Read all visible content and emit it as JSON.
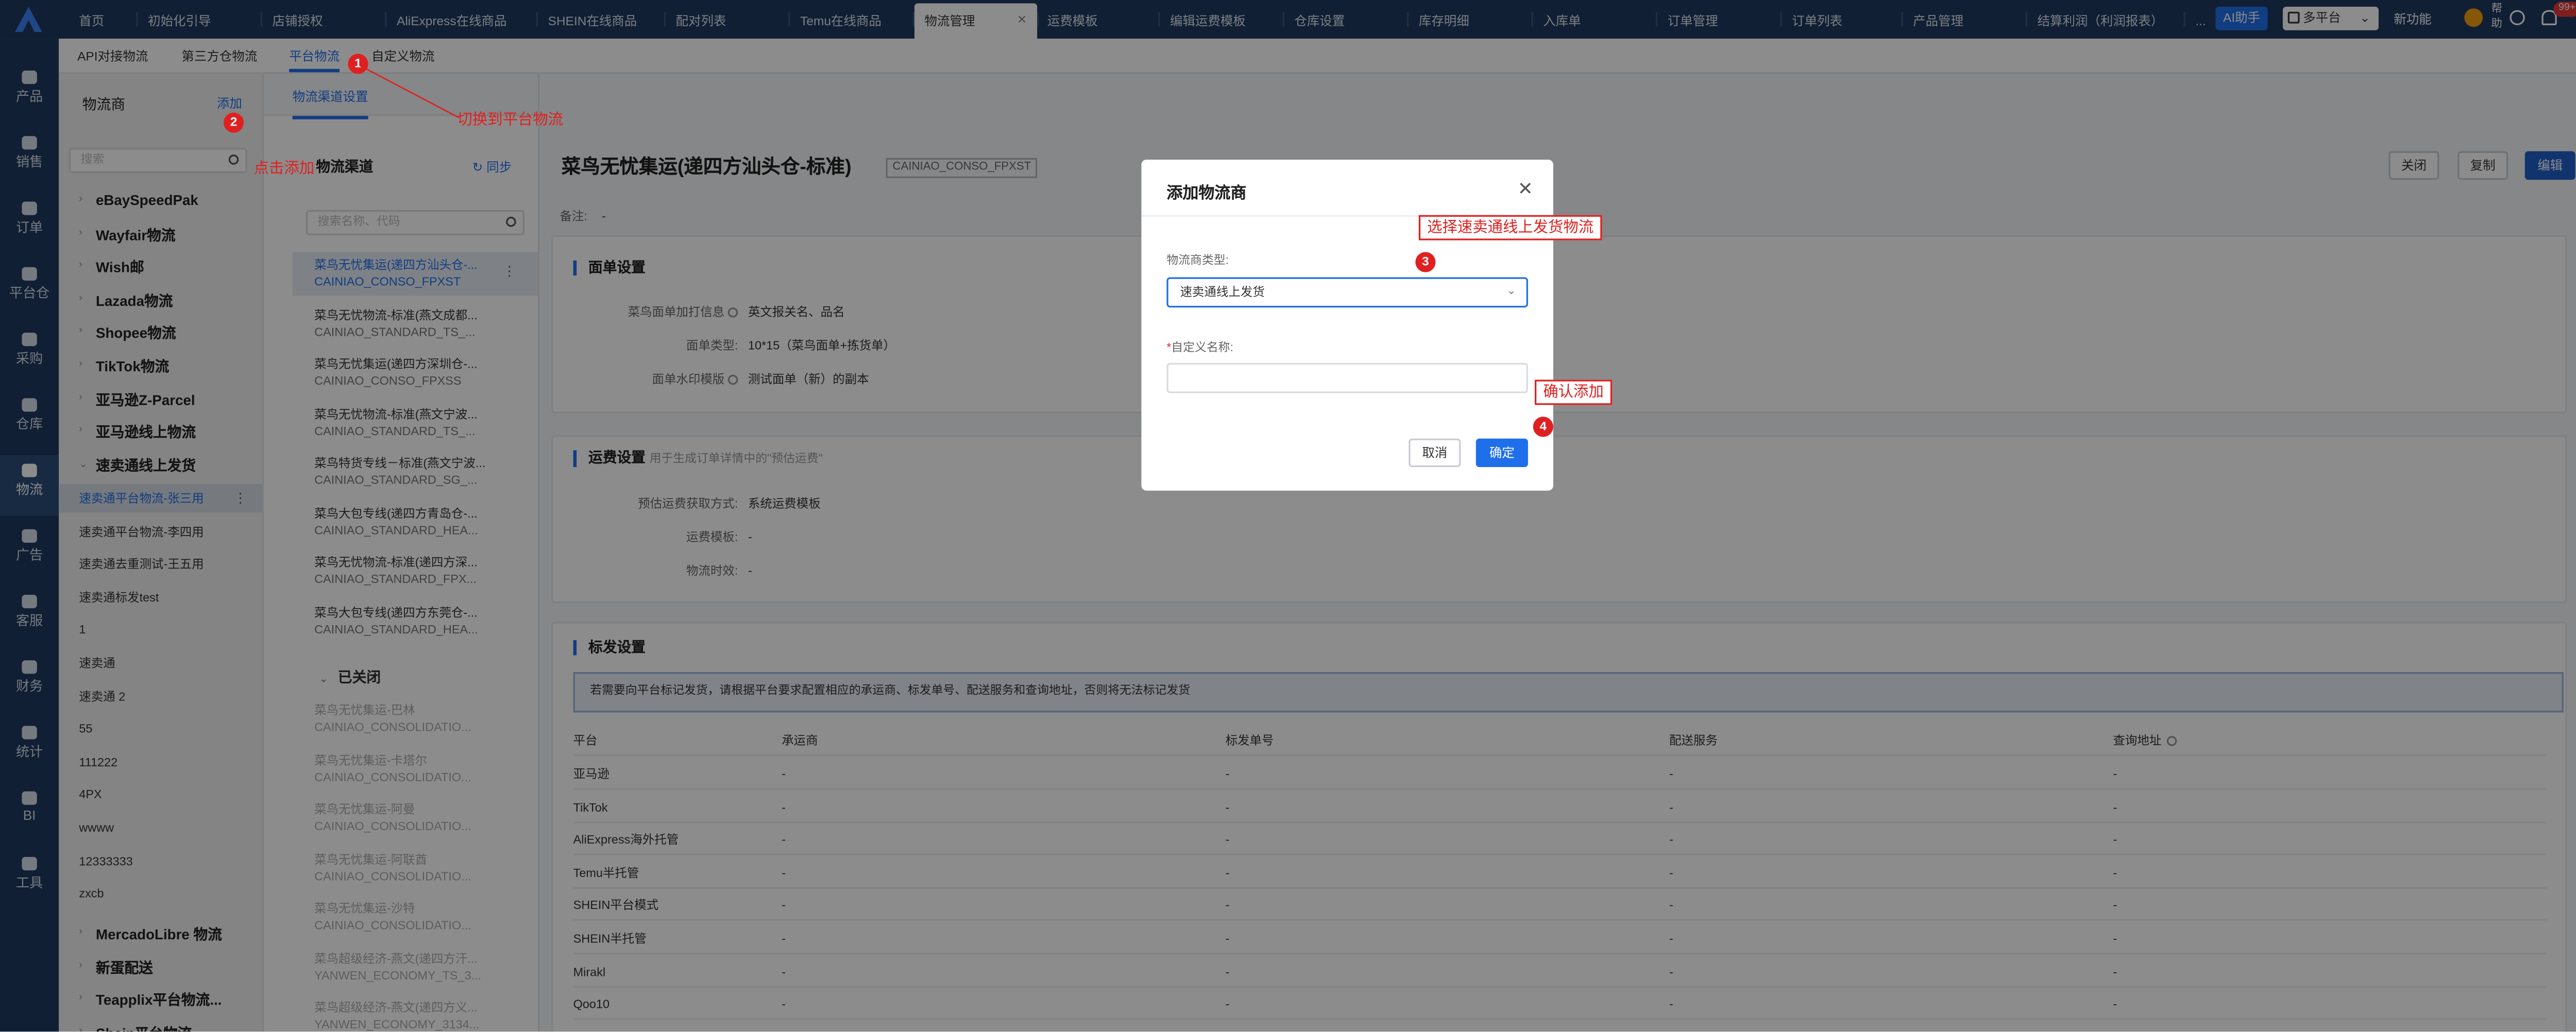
{
  "topbar": {
    "tabs": [
      "首页",
      "初始化引导",
      "店铺授权",
      "AliExpress在线商品",
      "SHEIN在线商品",
      "配对列表",
      "Temu在线商品",
      "物流管理",
      "运费模板",
      "编辑运费模板",
      "仓库设置",
      "库存明细",
      "入库单",
      "订单管理",
      "订单列表",
      "产品管理",
      "结算利润（利润报表）",
      "..."
    ],
    "active_tab": "物流管理",
    "ai_label": "AI助手",
    "platform_label": "多平台",
    "new_feature": "新功能",
    "help": "帮助",
    "notify_badge": "99+"
  },
  "rail": {
    "items": [
      "产品",
      "销售",
      "订单",
      "平台仓",
      "采购",
      "仓库",
      "物流",
      "广告",
      "客服",
      "财务",
      "统计",
      "BI",
      "工具"
    ],
    "active": "物流"
  },
  "subtabs": [
    "API对接物流",
    "第三方仓物流",
    "平台物流",
    "自定义物流"
  ],
  "active_subtab": "平台物流",
  "carriers": {
    "title": "物流商",
    "add": "添加",
    "search_placeholder": "搜索",
    "groups_top": [
      "eBaySpeedPak",
      "Wayfair物流",
      "Wish邮",
      "Lazada物流",
      "Shopee物流",
      "TikTok物流",
      "亚马逊Z-Parcel",
      "亚马逊线上物流",
      "速卖通线上发货"
    ],
    "items": [
      "速卖通平台物流-张三用",
      "速卖通平台物流-李四用",
      "速卖通去重测试-王五用",
      "速卖通标发test",
      "1",
      "速卖通",
      "速卖通 2",
      "55",
      "111222",
      "4PX",
      "wwww",
      "12333333",
      "zxcb"
    ],
    "selected_item": "速卖通平台物流-张三用",
    "groups_bottom": [
      "MercadoLibre 物流",
      "新蛋配送",
      "Teapplix平台物流...",
      "Shein平台物流"
    ]
  },
  "channels": {
    "tab": "物流渠道设置",
    "title": "物流渠道",
    "sync": "同步",
    "search_placeholder": "搜索名称、代码",
    "open": [
      {
        "name": "菜鸟无忧集运(递四方汕头仓-...",
        "code": "CAINIAO_CONSO_FPXST"
      },
      {
        "name": "菜鸟无忧物流-标准(燕文成都...",
        "code": "CAINIAO_STANDARD_TS_..."
      },
      {
        "name": "菜鸟无忧集运(递四方深圳仓-...",
        "code": "CAINIAO_CONSO_FPXSS"
      },
      {
        "name": "菜鸟无忧物流-标准(燕文宁波...",
        "code": "CAINIAO_STANDARD_TS_..."
      },
      {
        "name": "菜鸟特货专线－标准(燕文宁波...",
        "code": "CAINIAO_STANDARD_SG_..."
      },
      {
        "name": "菜鸟大包专线(递四方青岛仓-...",
        "code": "CAINIAO_STANDARD_HEA..."
      },
      {
        "name": "菜鸟无忧物流-标准(递四方深...",
        "code": "CAINIAO_STANDARD_FPX..."
      },
      {
        "name": "菜鸟大包专线(递四方东莞仓-...",
        "code": "CAINIAO_STANDARD_HEA..."
      }
    ],
    "closed_title": "已关闭",
    "closed": [
      {
        "name": "菜鸟无忧集运-巴林",
        "code": "CAINIAO_CONSOLIDATIO..."
      },
      {
        "name": "菜鸟无忧集运-卡塔尔",
        "code": "CAINIAO_CONSOLIDATIO..."
      },
      {
        "name": "菜鸟无忧集运-阿曼",
        "code": "CAINIAO_CONSOLIDATIO..."
      },
      {
        "name": "菜鸟无忧集运-阿联酋",
        "code": "CAINIAO_CONSOLIDATIO..."
      },
      {
        "name": "菜鸟无忧集运-沙特",
        "code": "CAINIAO_CONSOLIDATIO..."
      },
      {
        "name": "菜鸟超级经济-燕文(递四方汗...",
        "code": "YANWEN_ECONOMY_TS_3..."
      },
      {
        "name": "菜鸟超级经济-燕文(递四方义...",
        "code": "YANWEN_ECONOMY_3134..."
      }
    ]
  },
  "detail": {
    "title": "菜鸟无忧集运(递四方汕头仓-标准)",
    "code": "CAINIAO_CONSO_FPXST",
    "btn_close": "关闭",
    "btn_copy": "复制",
    "btn_edit": "编辑",
    "remark_label": "备注:",
    "remark_value": "-",
    "face": {
      "title": "面单设置",
      "rows": [
        {
          "k": "菜鸟面单加打信息",
          "v": "英文报关名、品名"
        },
        {
          "k": "面单类型:",
          "v": "10*15（菜鸟面单+拣货单）"
        },
        {
          "k": "面单水印模版",
          "v": "测试面单（新）的副本"
        }
      ]
    },
    "freight": {
      "title": "运费设置",
      "subtitle": "用于生成订单详情中的\"预估运费\"",
      "rows": [
        {
          "k": "预估运费获取方式:",
          "v": "系统运费模板"
        },
        {
          "k": "运费模板:",
          "v": "-"
        },
        {
          "k": "物流时效:",
          "v": "-"
        }
      ]
    },
    "mark": {
      "title": "标发设置",
      "notice": "若需要向平台标记发货，请根据平台要求配置相应的承运商、标发单号、配送服务和查询地址，否则将无法标记发货",
      "columns": [
        "平台",
        "承运商",
        "标发单号",
        "配送服务",
        "查询地址"
      ],
      "rows": [
        "亚马逊",
        "TikTok",
        "AliExpress海外托管",
        "Temu半托管",
        "SHEIN平台模式",
        "SHEIN半托管",
        "Mirakl",
        "Qoo10"
      ],
      "empty": "-"
    }
  },
  "modal": {
    "title": "添加物流商",
    "type_label": "物流商类型:",
    "type_value": "速卖通线上发货",
    "name_label": "自定义名称:",
    "name_value": "",
    "cancel": "取消",
    "ok": "确定"
  },
  "annotations": {
    "n1": "1",
    "n2": "2",
    "n3": "3",
    "n4": "4",
    "note1": "切换到平台物流",
    "note2": "点击添加",
    "note3": "选择速卖通线上发货物流",
    "note4": "确认添加"
  },
  "colors": {
    "navy": "#1f3a60",
    "accent": "#1f6feb",
    "annotation_red": "#e02020"
  }
}
